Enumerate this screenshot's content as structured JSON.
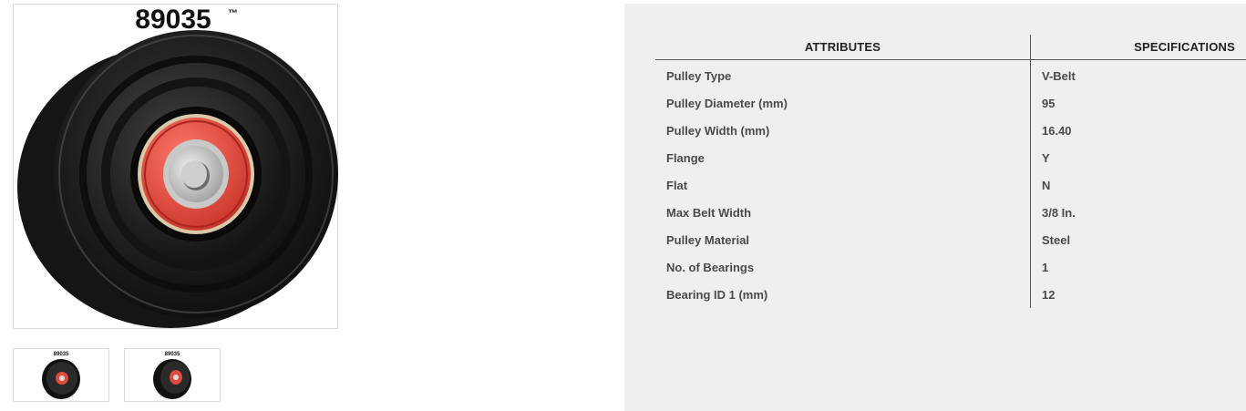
{
  "product": {
    "part_number": "89035",
    "trademark": "™"
  },
  "gallery": {
    "thumbnails": [
      {
        "label": "89035"
      },
      {
        "label": "89035"
      }
    ]
  },
  "specs": {
    "header_attributes": "ATTRIBUTES",
    "header_specifications": "SPECIFICATIONS",
    "rows": [
      {
        "attribute": "Pulley Type",
        "value": "V-Belt"
      },
      {
        "attribute": "Pulley Diameter (mm)",
        "value": "95"
      },
      {
        "attribute": "Pulley Width (mm)",
        "value": "16.40"
      },
      {
        "attribute": "Flange",
        "value": "Y"
      },
      {
        "attribute": "Flat",
        "value": "N"
      },
      {
        "attribute": "Max Belt Width",
        "value": "3/8 In."
      },
      {
        "attribute": "Pulley Material",
        "value": "Steel"
      },
      {
        "attribute": "No. of Bearings",
        "value": "1"
      },
      {
        "attribute": "Bearing ID 1 (mm)",
        "value": "12"
      }
    ]
  },
  "colors": {
    "panel_background": "#efefef",
    "bearing_seal": "#e04a3c",
    "pulley_body": "#1c1c1c"
  }
}
